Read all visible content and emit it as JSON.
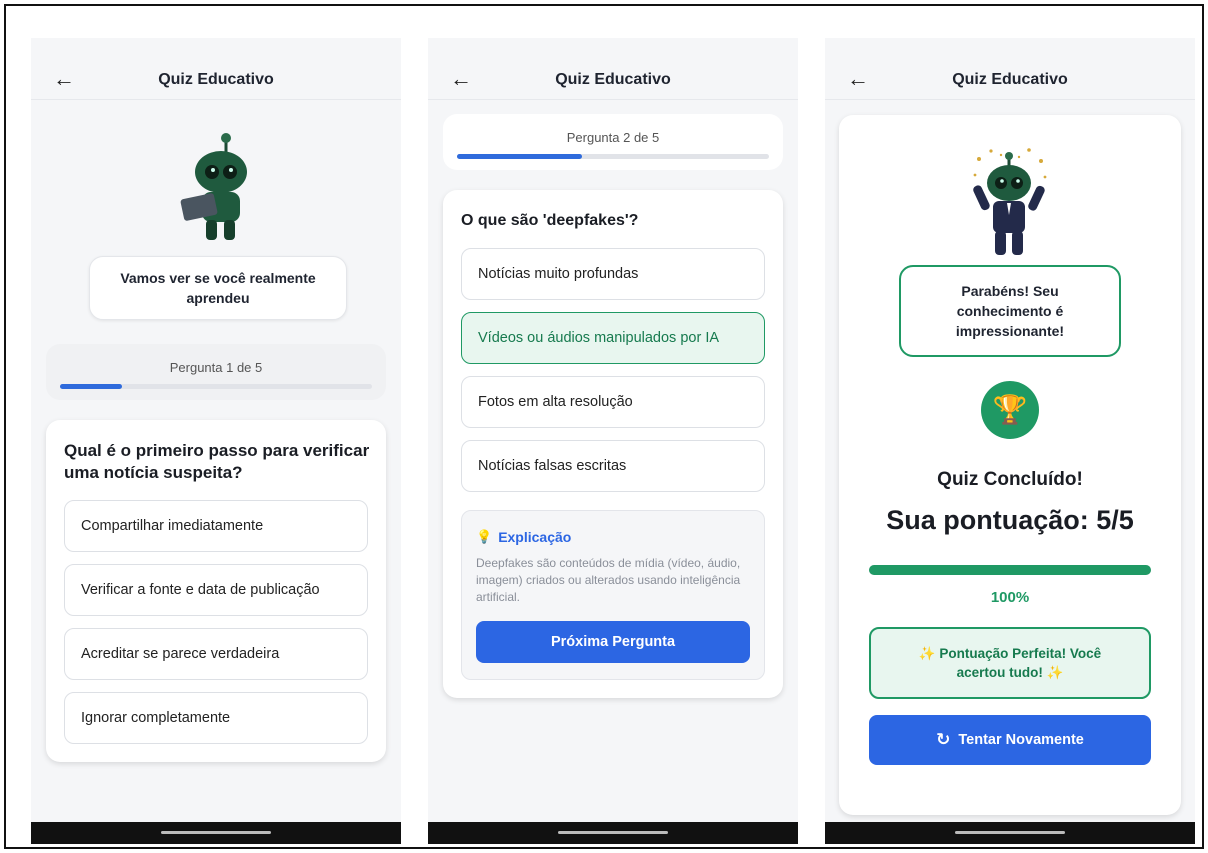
{
  "app": {
    "title": "Quiz Educativo"
  },
  "screen1": {
    "speech": "Vamos ver se você realmente aprendeu",
    "progress_label": "Pergunta 1 de 5",
    "progress_fraction": 0.2,
    "question": "Qual é o primeiro passo para verificar uma notícia suspeita?",
    "options": [
      "Compartilhar imediatamente",
      "Verificar a fonte e data de publicação",
      "Acreditar se parece verdadeira",
      "Ignorar completamente"
    ]
  },
  "screen2": {
    "progress_label": "Pergunta 2 de 5",
    "progress_fraction": 0.4,
    "question": "O que são 'deepfakes'?",
    "options": [
      "Notícias muito profundas",
      "Vídeos ou áudios manipulados por IA",
      "Fotos em alta resolução",
      "Notícias falsas escritas"
    ],
    "selected_index": 1,
    "explanation_title": "Explicação",
    "explanation_text": "Deepfakes são conteúdos de mídia (vídeo, áudio, imagem) criados ou alterados usando inteligência artificial.",
    "next_label": "Próxima Pergunta"
  },
  "screen3": {
    "speech": "Parabéns! Seu conhecimento é impressionante!",
    "done_title": "Quiz Concluído!",
    "score": "Sua pontuação: 5/5",
    "percent": "100%",
    "percent_fraction": 1.0,
    "perfect": "✨ Pontuação Perfeita! Você acertou tudo! ✨",
    "retry_label": "Tentar Novamente"
  },
  "colors": {
    "accent_blue": "#2c66e3",
    "success_green": "#1f9964",
    "success_bg": "#e8f6ef",
    "robot_green": "#1c4a34"
  },
  "icons": [
    "back-arrow-icon",
    "robot-mascot",
    "lightbulb-icon",
    "trophy-icon",
    "refresh-icon"
  ]
}
